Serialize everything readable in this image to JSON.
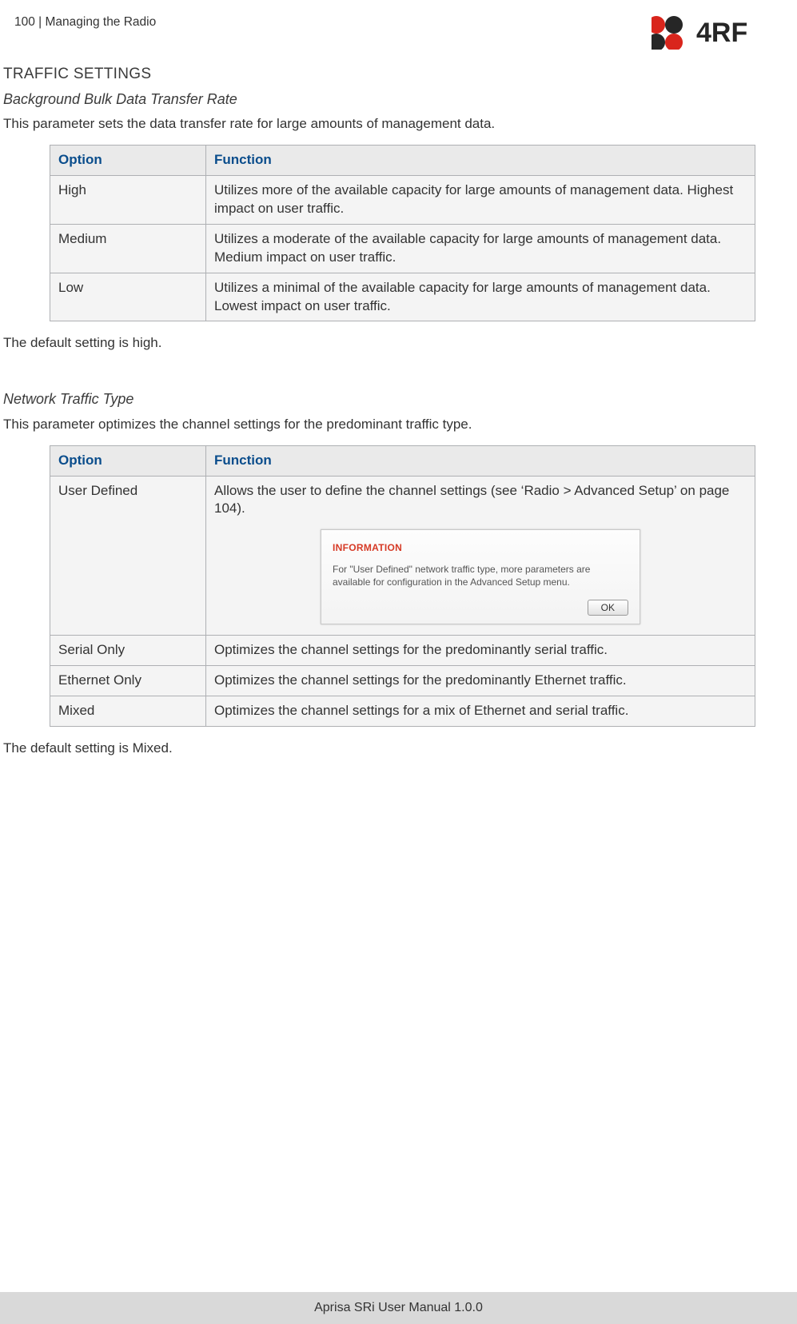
{
  "header": {
    "page_label": "100  |  Managing the Radio"
  },
  "logo": {
    "text": "4RF"
  },
  "section": {
    "title": "TRAFFIC SETTINGS",
    "param1": {
      "title": "Background Bulk Data Transfer Rate",
      "desc": "This parameter sets the data transfer rate for large amounts of management data.",
      "table": {
        "headers": {
          "option": "Option",
          "function": "Function"
        },
        "rows": [
          {
            "option": "High",
            "function": "Utilizes more of the available capacity for large amounts of management data. Highest impact on user traffic."
          },
          {
            "option": "Medium",
            "function": "Utilizes a moderate of the available capacity for large amounts of management data. Medium impact on user traffic."
          },
          {
            "option": "Low",
            "function": "Utilizes a minimal of the available capacity for large amounts of management data. Lowest impact on user traffic."
          }
        ]
      },
      "default_note": "The default setting is high."
    },
    "param2": {
      "title": "Network Traffic Type",
      "desc": "This parameter optimizes the channel settings for the predominant traffic type.",
      "table": {
        "headers": {
          "option": "Option",
          "function": "Function"
        },
        "rows": [
          {
            "option": "User Defined",
            "function": "Allows the user to define the channel settings (see ‘Radio > Advanced Setup’ on page 104).",
            "dialog": {
              "title": "INFORMATION",
              "body": "For \"User Defined\" network traffic type, more parameters are available for configuration in the Advanced Setup menu.",
              "ok": "OK"
            }
          },
          {
            "option": "Serial Only",
            "function": "Optimizes the channel settings for the predominantly serial traffic."
          },
          {
            "option": "Ethernet Only",
            "function": "Optimizes the channel settings for the predominantly Ethernet traffic."
          },
          {
            "option": "Mixed",
            "function": "Optimizes the channel settings for a mix of Ethernet and serial traffic."
          }
        ]
      },
      "default_note": "The default setting is Mixed."
    }
  },
  "footer": {
    "text": "Aprisa SRi User Manual 1.0.0"
  }
}
